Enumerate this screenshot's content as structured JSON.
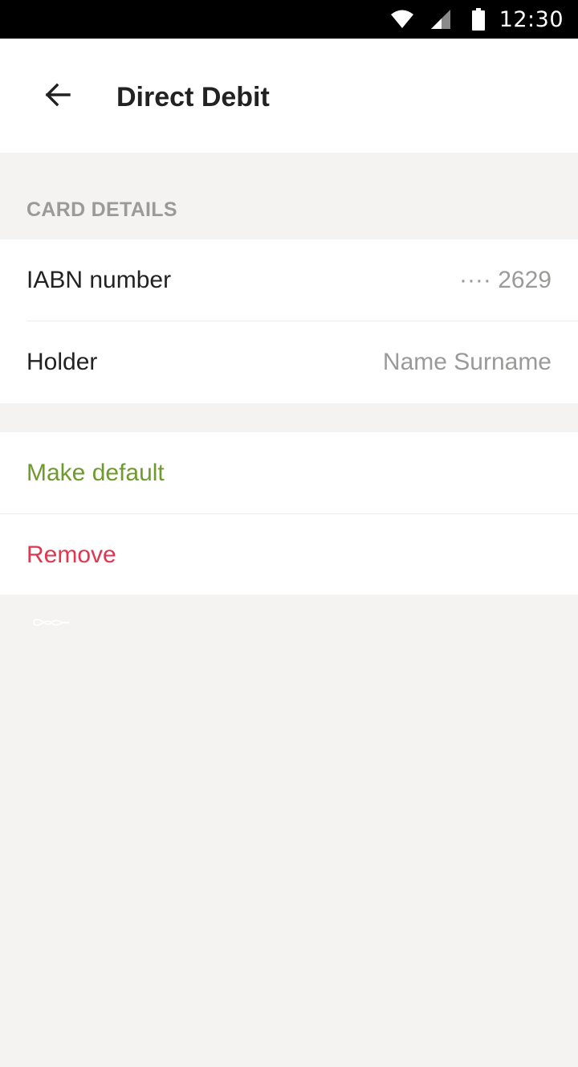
{
  "status_bar": {
    "time": "12:30",
    "icons": [
      "wifi-icon",
      "signal-icon",
      "battery-icon"
    ]
  },
  "header": {
    "back_icon": "arrow-left-icon",
    "title": "Direct Debit"
  },
  "card_details": {
    "section_title": "CARD DETAILS",
    "rows": [
      {
        "label": "IABN number",
        "value": "···· 2629"
      },
      {
        "label": "Holder",
        "value": "Name Surname"
      }
    ]
  },
  "actions": {
    "make_default": {
      "label": "Make default",
      "color": "#6f9a2c"
    },
    "remove": {
      "label": "Remove",
      "color": "#e0364f"
    }
  },
  "footer_icon": "infinity-icon",
  "colors": {
    "background": "#f4f3f1",
    "surface": "#ffffff",
    "muted_text": "#9b9a98",
    "primary_text": "#222222"
  }
}
